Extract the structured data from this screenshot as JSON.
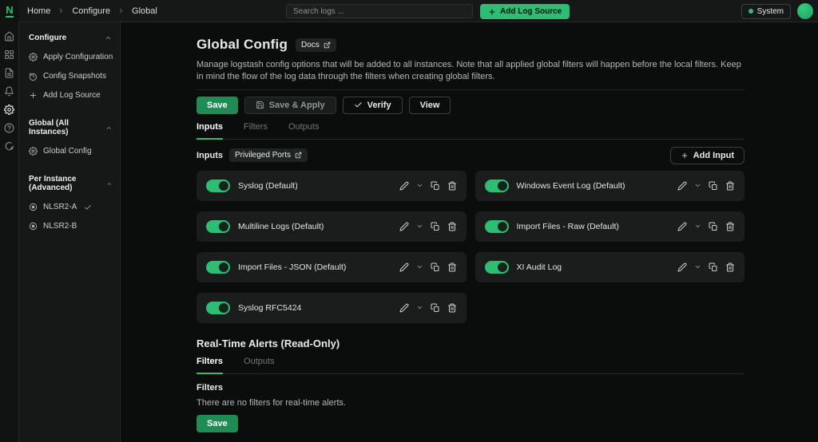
{
  "header": {
    "logo_text": "N",
    "breadcrumb": [
      "Home",
      "Configure",
      "Global"
    ],
    "search_placeholder": "Search logs ...",
    "add_log_source_label": "Add Log Source",
    "system_label": "System"
  },
  "icons": {
    "rail": [
      "home-icon",
      "dashboard-icon",
      "document-icon",
      "bell-icon",
      "gear-icon",
      "help-icon",
      "support-icon"
    ],
    "card_actions": [
      "edit-icon",
      "chevron-down-icon",
      "copy-icon",
      "trash-icon"
    ]
  },
  "colors": {
    "accent_green": "#2ebe73",
    "save_button_green": "#1f8b55",
    "background": "#0b0d0c",
    "card_background": "#1a1d1b"
  },
  "sidebar": {
    "sections": [
      {
        "label": "Configure",
        "items": [
          {
            "icon": "gear-icon",
            "label": "Apply Configuration"
          },
          {
            "icon": "history-icon",
            "label": "Config Snapshots"
          },
          {
            "icon": "plus-icon",
            "label": "Add Log Source"
          }
        ]
      },
      {
        "label": "Global (All Instances)",
        "items": [
          {
            "icon": "gear-icon",
            "label": "Global Config"
          }
        ]
      },
      {
        "label": "Per Instance (Advanced)",
        "items": [
          {
            "icon": "radio-icon",
            "label": "NLSR2-A",
            "checked": true
          },
          {
            "icon": "radio-icon",
            "label": "NLSR2-B",
            "checked": false
          }
        ]
      }
    ]
  },
  "main": {
    "title": "Global Config",
    "docs_label": "Docs",
    "description": "Manage logstash config options that will be added to all instances. Note that all applied global filters will happen before the local filters. Keep in mind the flow of the log data through the filters when creating global filters.",
    "buttons": {
      "save": "Save",
      "save_apply": "Save & Apply",
      "verify": "Verify",
      "view": "View"
    },
    "tabs": [
      "Inputs",
      "Filters",
      "Outputs"
    ],
    "active_tab": "Inputs",
    "inputs_label": "Inputs",
    "privileged_ports_label": "Privileged Ports",
    "add_input_label": "Add Input",
    "cards": [
      {
        "label": "Syslog (Default)",
        "enabled": true
      },
      {
        "label": "Windows Event Log (Default)",
        "enabled": true
      },
      {
        "label": "Multiline Logs (Default)",
        "enabled": true
      },
      {
        "label": "Import Files - Raw (Default)",
        "enabled": true
      },
      {
        "label": "Import Files - JSON (Default)",
        "enabled": true
      },
      {
        "label": "XI Audit Log",
        "enabled": true
      },
      {
        "label": "Syslog RFC5424",
        "enabled": true
      }
    ],
    "alerts": {
      "title": "Real-Time Alerts (Read-Only)",
      "tabs": [
        "Filters",
        "Outputs"
      ],
      "active_tab": "Filters",
      "filters_label": "Filters",
      "empty_text": "There are no filters for real-time alerts.",
      "save_label": "Save"
    }
  }
}
